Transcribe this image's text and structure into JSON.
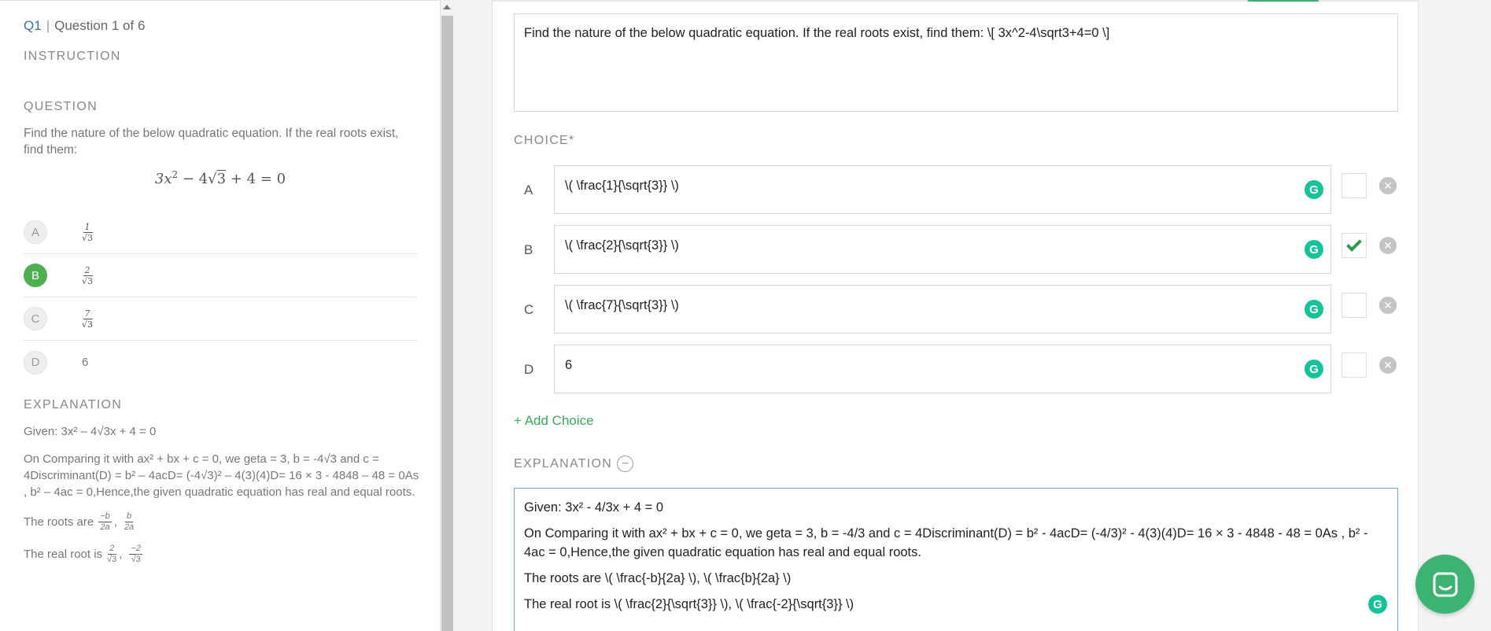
{
  "preview": {
    "q_number": "Q1",
    "q_of": "Question 1 of 6",
    "instruction_label": "INSTRUCTION",
    "question_label": "QUESTION",
    "question_text": "Find the nature of the below quadratic equation. If the real roots exist, find them:",
    "equation": {
      "a": "3x",
      "exp": "2",
      "mid": " − 4",
      "root": "√",
      "radicand": "3",
      "rest": " + 4 = 0"
    },
    "choices": [
      {
        "letter": "A",
        "num": "1",
        "den_root": "√",
        "den_val": "3",
        "correct": false
      },
      {
        "letter": "B",
        "num": "2",
        "den_root": "√",
        "den_val": "3",
        "correct": true
      },
      {
        "letter": "C",
        "num": "7",
        "den_root": "√",
        "den_val": "3",
        "correct": false
      },
      {
        "letter": "D",
        "value": "6",
        "correct": false
      }
    ],
    "explanation_label": "EXPLANATION",
    "exp_given": "Given: 3x² – 4√3x + 4 = 0",
    "exp_compare": "On Comparing it with ax² + bx + c = 0, we geta = 3, b = -4√3 and c = 4Discriminant(D) = b² – 4acD= (-4√3)² – 4(3)(4)D= 16 × 3 - 4848 – 48 = 0As , b² – 4ac = 0,Hence,the given quadratic equation has real and equal roots.",
    "roots_prefix": "The roots are",
    "roots_f1_num": "−b",
    "roots_f1_den": "2a",
    "roots_f2_num": "b",
    "roots_f2_den": "2a",
    "real_prefix": "The real root is",
    "real_f1_num": "2",
    "real_f2_num": "−2",
    "real_den_root": "√",
    "real_den_val": "3",
    "comma": ","
  },
  "editor": {
    "question_value": "Find the nature of the below quadratic equation. If the real roots exist, find them: \\[ 3x^2-4\\sqrt3+4=0 \\]",
    "choice_label": "CHOICE*",
    "choices": [
      {
        "letter": "A",
        "value": "\\( \\frac{1}{\\sqrt{3}} \\)",
        "checked": false
      },
      {
        "letter": "B",
        "value": "\\( \\frac{2}{\\sqrt{3}} \\)",
        "checked": true
      },
      {
        "letter": "C",
        "value": "\\( \\frac{7}{\\sqrt{3}} \\)",
        "checked": false
      },
      {
        "letter": "D",
        "value": "6",
        "checked": false
      }
    ],
    "add_choice": "+ Add Choice",
    "explanation_label": "EXPLANATION",
    "collapse_symbol": "−",
    "explanation_lines": [
      "Given: 3x² - 4/3x + 4 = 0",
      "On Comparing it with ax² + bx + c = 0, we geta = 3, b = -4/3 and c = 4Discriminant(D) = b² - 4acD= (-4/3)² - 4(3)(4)D= 16 × 3 - 4848 - 48 = 0As , b² - 4ac = 0,Hence,the given quadratic equation has real and equal roots.",
      "The roots are \\( \\frac{-b}{2a} \\), \\( \\frac{b}{2a} \\)",
      "The real root is \\( \\frac{2}{\\sqrt{3}} \\), \\( \\frac{-2}{\\sqrt{3}} \\)"
    ],
    "grammarly_glyph": "G",
    "remove_glyph": "✕"
  },
  "colors": {
    "accent": "#3cb371",
    "link": "#3b6fa0",
    "grammarly": "#15c39a"
  },
  "icons": [
    "grammarly-icon",
    "remove-icon",
    "check-icon",
    "collapse-icon",
    "chat-icon"
  ]
}
